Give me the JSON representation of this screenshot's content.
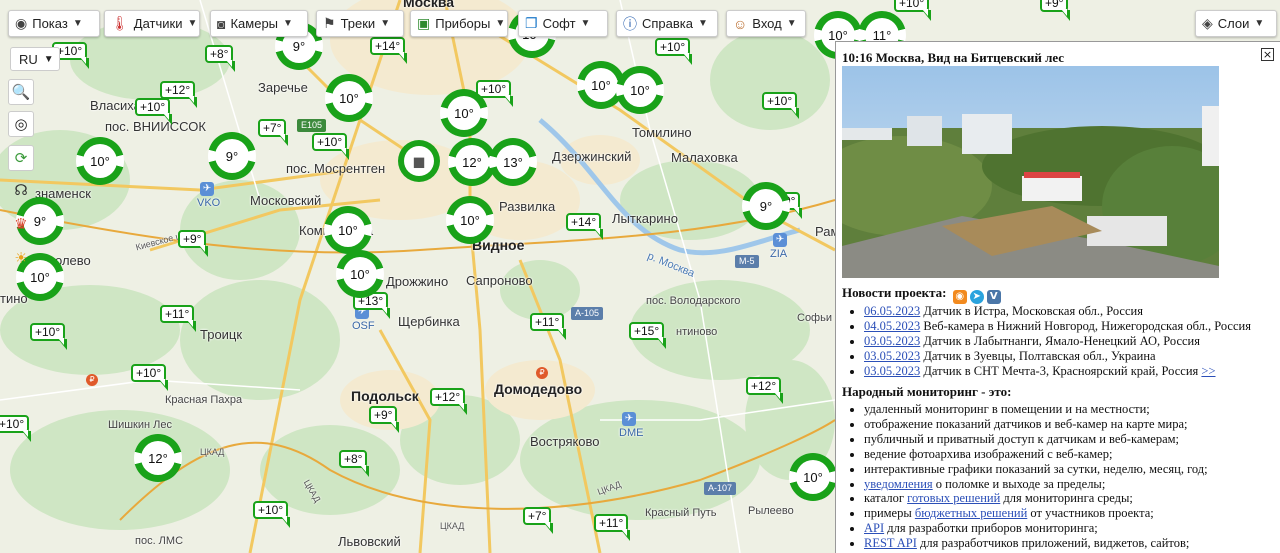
{
  "toolbar": {
    "show": {
      "label": "Показ",
      "icon": "eye-icon"
    },
    "sensors": {
      "label": "Датчики",
      "icon": "thermometer-icon"
    },
    "cameras": {
      "label": "Камеры",
      "icon": "camera-icon"
    },
    "tracks": {
      "label": "Треки",
      "icon": "flag-icon"
    },
    "devices": {
      "label": "Приборы",
      "icon": "device-icon"
    },
    "software": {
      "label": "Софт",
      "icon": "windows-icon"
    },
    "help": {
      "label": "Справка",
      "icon": "info-icon"
    },
    "login": {
      "label": "Вход",
      "icon": "user-icon"
    },
    "layers": {
      "label": "Слои",
      "icon": "layers-icon"
    }
  },
  "language": "RU",
  "map": {
    "places": {
      "moscow": "Москва",
      "zarechye": "Заречье",
      "vlasikha": "Власиха",
      "vniissok": "пос. ВНИИССОК",
      "mosrentgen": "пос. Мосрентген",
      "moskovsky": "Московский",
      "znamensk": "знаменск",
      "kommunarka": "Коммунарка",
      "vidnoe": "Видное",
      "razvilka": "Развилка",
      "dzerzhinsky": "Дзержинский",
      "malakhovka": "Малаховка",
      "tomilino": "Томилино",
      "lytkarino": "Лыткарино",
      "drozhzhino": "Дрожжино",
      "sapronovo": "Сапроново",
      "shcherbinka": "Щербинка",
      "troitsk": "Троицк",
      "podolsk": "Подольск",
      "domodedovo": "Домодедово",
      "vostryakovo": "Востряково",
      "krasnaya_pakhra": "Красная Пахра",
      "shishkin_les": "Шишкин Лес",
      "lvovsky": "Львовский",
      "krasny_put": "Красный Путь",
      "ryleevo": "Рылеево",
      "volodarsky": "пос. Володарского",
      "ostrovtsy": "нтиново",
      "sofino": "Софьи",
      "pos_lms": "пос. ЛМС",
      "ozerki": "олево",
      "tino": "тино",
      "moskva_river": "р. Москва",
      "kievskoe": "Киевское ш.",
      "rams": "Рам"
    },
    "roads": {
      "e105": "E105",
      "m5": "M-5",
      "a105": "A-105",
      "a107": "A-107",
      "ckad1": "ЦКАД",
      "ckad2": "ЦКАД",
      "ckad3": "ЦКАД",
      "ckad4": "ЦКАД"
    },
    "airports": {
      "vko": "VKO",
      "zia": "ZIA",
      "osf": "OSF",
      "dme": "DME"
    },
    "sensors": [
      {
        "t": "+10°"
      },
      {
        "t": "+8°"
      },
      {
        "t": "+12°"
      },
      {
        "t": "+10°"
      },
      {
        "t": "+7°"
      },
      {
        "t": "+10°"
      },
      {
        "t": "+14°"
      },
      {
        "t": "+10°"
      },
      {
        "t": "+10°"
      },
      {
        "t": "+10°"
      },
      {
        "t": "+14°"
      },
      {
        "t": "+9°"
      },
      {
        "t": "+9°"
      },
      {
        "t": "+13°"
      },
      {
        "t": "+11°"
      },
      {
        "t": "+11°"
      },
      {
        "t": "+15°"
      },
      {
        "t": "+10°"
      },
      {
        "t": "+10°"
      },
      {
        "t": "+12°"
      },
      {
        "t": "+9°"
      },
      {
        "t": "+12°"
      },
      {
        "t": "+10°"
      },
      {
        "t": "+8°"
      },
      {
        "t": "+10°"
      },
      {
        "t": "+7°"
      },
      {
        "t": "+11°"
      },
      {
        "t": "+10°"
      },
      {
        "t": "+9°"
      }
    ],
    "cameras": [
      {
        "t": "9°"
      },
      {
        "t": "10°"
      },
      {
        "t": "10°"
      },
      {
        "t": "10°"
      },
      {
        "t": "9°"
      },
      {
        "t": "10°"
      },
      {
        "t": "10°"
      },
      {
        "t": "12°"
      },
      {
        "t": "13°"
      },
      {
        "t": "10°"
      },
      {
        "t": "10°"
      },
      {
        "t": "10°"
      },
      {
        "t": "10°"
      },
      {
        "t": "9°"
      },
      {
        "t": "10°"
      },
      {
        "t": "11°"
      },
      {
        "t": "9°"
      },
      {
        "t": "10°"
      },
      {
        "t": "12°"
      },
      {
        "t": "10°"
      }
    ]
  },
  "panel": {
    "title": "10:16 Москва, Вид на Битцевский лес",
    "news_heading": "Новости проекта:",
    "news": [
      {
        "date": "06.05.2023",
        "text": "Датчик в Истра, Московская обл., Россия"
      },
      {
        "date": "04.05.2023",
        "text": "Веб-камера в Нижний Новгород, Нижегородская обл., Россия"
      },
      {
        "date": "03.05.2023",
        "text": "Датчик в Лабытнанги, Ямало-Ненецкий АО, Россия"
      },
      {
        "date": "03.05.2023",
        "text": "Датчик в Зуевцы, Полтавская обл., Украина"
      },
      {
        "date": "03.05.2023",
        "text": "Датчик в СНТ Мечта-3, Красноярский край, Россия",
        "more": ">>"
      }
    ],
    "about_heading": "Народный мониторинг - это:",
    "about": [
      {
        "text": "удаленный мониторинг в помещении и на местности;"
      },
      {
        "text": "отображение показаний датчиков и веб-камер на карте мира;"
      },
      {
        "text": "публичный и приватный доступ к датчикам и веб-камерам;"
      },
      {
        "text": "ведение фотоархива изображений с веб-камер;"
      },
      {
        "text": "интерактивные графики показаний за сутки, неделю, месяц, год;"
      },
      {
        "link": "уведомления",
        "text": " о поломке и выходе за пределы;"
      },
      {
        "pre": "каталог ",
        "link": "готовых решений",
        "text": " для мониторинга среды;"
      },
      {
        "pre": "примеры ",
        "link": "бюджетных решений",
        "text": " от участников проекта;"
      },
      {
        "link": "API",
        "text": " для разработки приборов мониторинга;"
      },
      {
        "link": "REST API",
        "text": " для разработчиков приложений, виджетов, сайтов;"
      }
    ]
  }
}
